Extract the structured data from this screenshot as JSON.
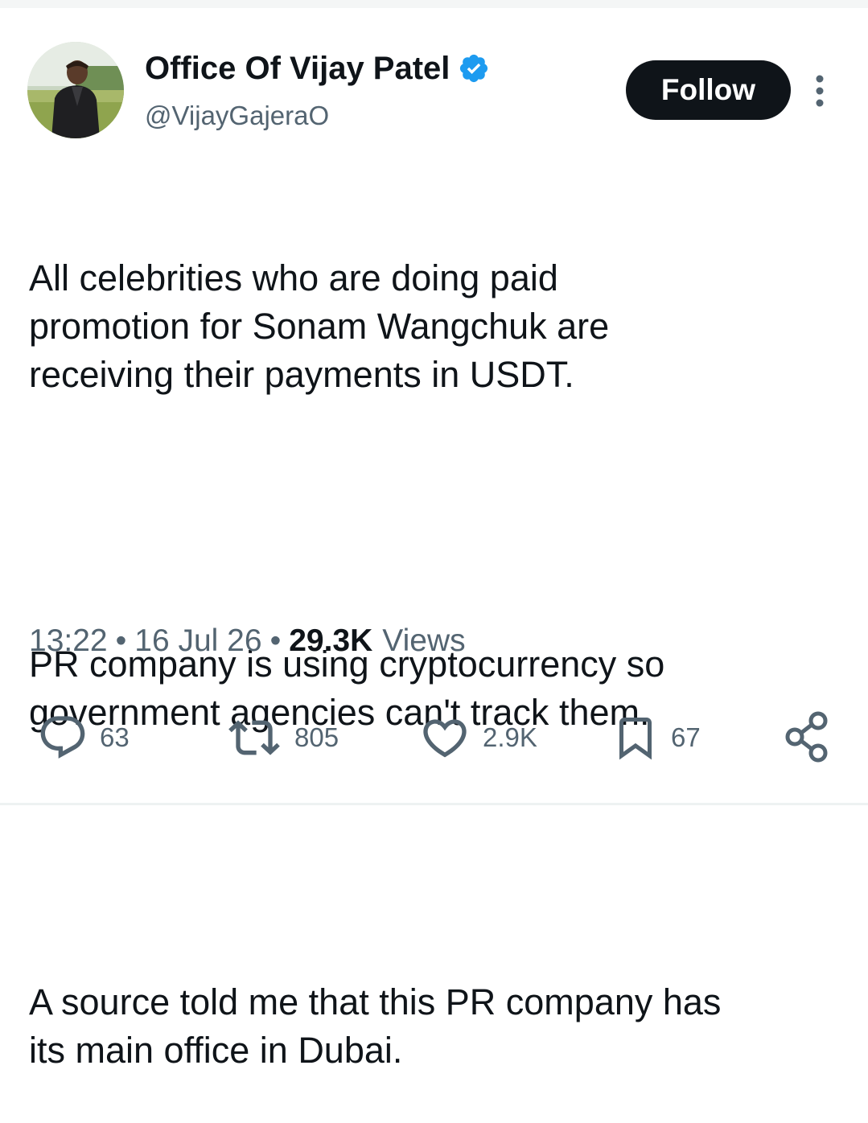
{
  "author": {
    "display_name": "Office Of Vijay Patel",
    "handle": "@VijayGajeraO",
    "verified": true,
    "verified_color": "#1d9bf0"
  },
  "follow_button": {
    "label": "Follow"
  },
  "tweet": {
    "paragraphs": [
      "All celebrities who are doing paid\npromotion for Sonam Wangchuk are\nreceiving their payments in USDT.",
      "PR company is using cryptocurrency so\ngovernment agencies can't track them.",
      "A source told me that this PR company has\nits main office in Dubai."
    ]
  },
  "meta": {
    "time": "13:22",
    "separator": "•",
    "date": "16 Jul 26",
    "views_count": "29.3K",
    "views_label": "Views"
  },
  "actions": {
    "replies": {
      "icon": "reply-icon",
      "count": "63"
    },
    "reposts": {
      "icon": "repost-icon",
      "count": "805"
    },
    "likes": {
      "icon": "heart-icon",
      "count": "2.9K"
    },
    "bookmarks": {
      "icon": "bookmark-icon",
      "count": "67"
    },
    "share": {
      "icon": "share-icon"
    }
  },
  "colors": {
    "text_primary": "#0f1419",
    "text_secondary": "#536471",
    "follow_bg": "#0f1419",
    "follow_text": "#ffffff"
  }
}
